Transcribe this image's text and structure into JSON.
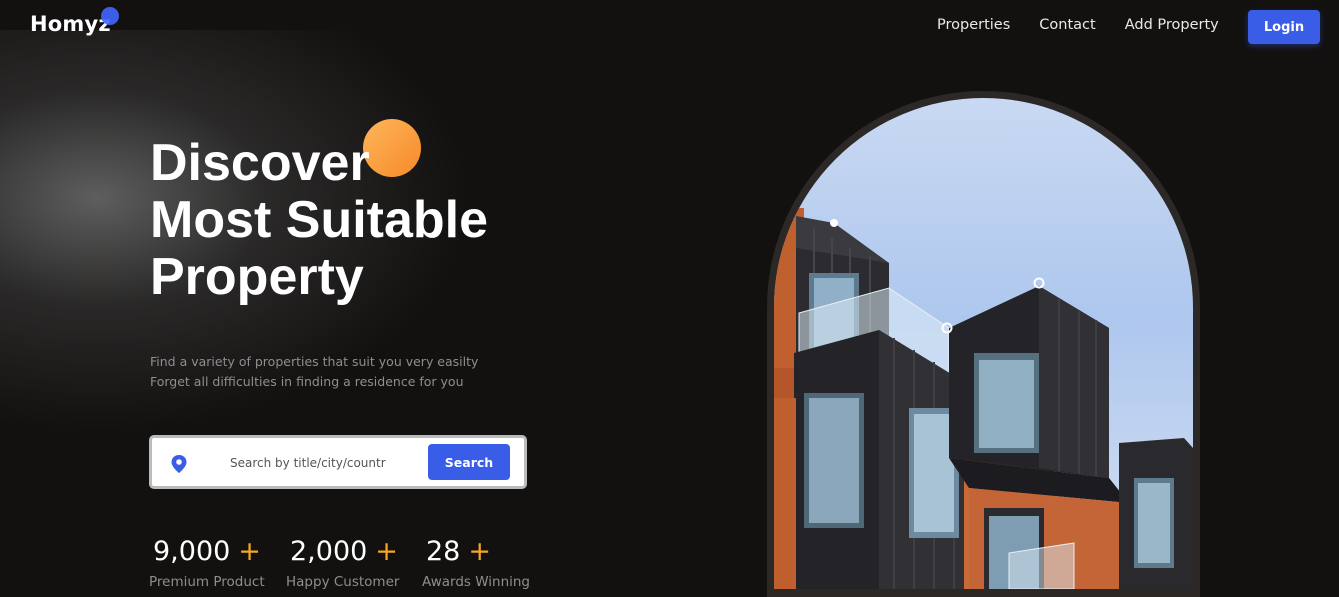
{
  "header": {
    "logo": "Homyz",
    "nav": [
      {
        "label": "Properties"
      },
      {
        "label": "Contact"
      },
      {
        "label": "Add Property"
      }
    ],
    "login_label": "Login"
  },
  "hero": {
    "title_lines": [
      "Discover",
      "Most Suitable",
      "Property"
    ],
    "subtitle_lines": [
      "Find a variety of properties that suit you very easilty",
      "Forget all difficulties in finding a residence for you"
    ],
    "search": {
      "placeholder": "Search by title/city/country",
      "button_label": "Search",
      "icon": "location-pin-icon"
    },
    "stats": [
      {
        "value": "9,000",
        "suffix": "+",
        "label": "Premium Product"
      },
      {
        "value": "2,000",
        "suffix": "+",
        "label": "Happy Customer"
      },
      {
        "value": "28",
        "suffix": "+",
        "label": "Awards Winning"
      }
    ]
  },
  "colors": {
    "background": "#131110",
    "accent_blue": "#3a5de8",
    "accent_orange": "#f5a623"
  }
}
